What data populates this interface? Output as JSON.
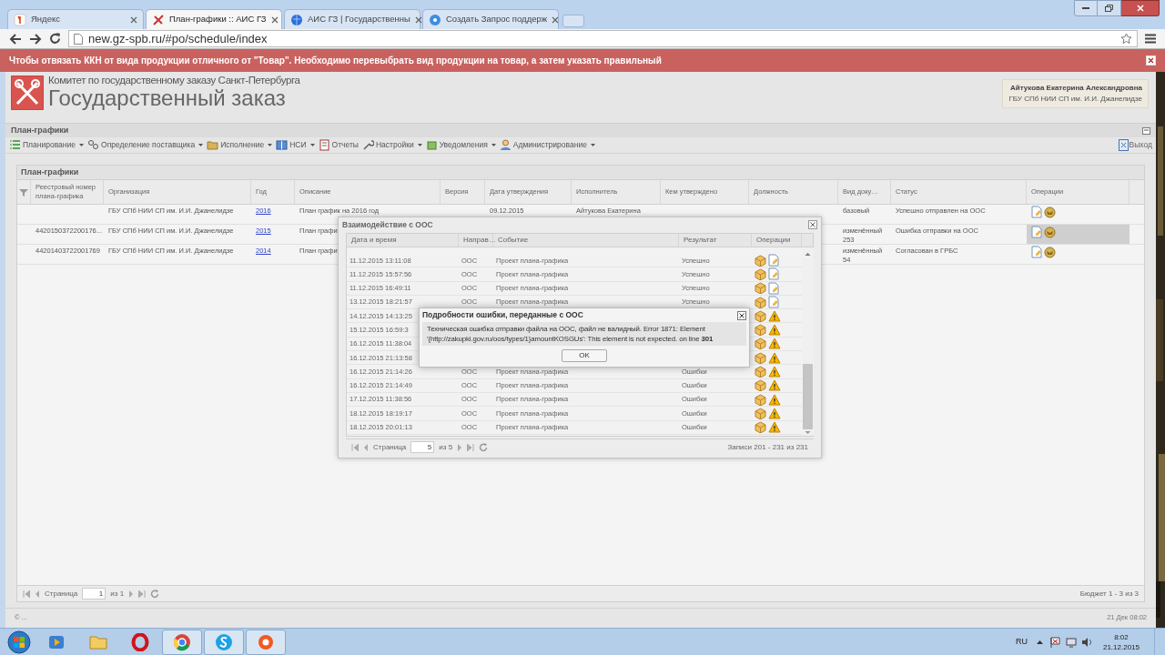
{
  "browser": {
    "tabs": [
      {
        "title": "Яндекс",
        "selected": false
      },
      {
        "title": "План-графики :: АИС ГЗ",
        "selected": true
      },
      {
        "title": "АИС ГЗ | Государственны",
        "selected": false
      },
      {
        "title": "Создать Запрос поддерж",
        "selected": false
      }
    ],
    "url": "new.gz-spb.ru/#po/schedule/index"
  },
  "banner": {
    "message": "Чтобы отвязать ККН от вида продукции отличного от \"Товар\". Необходимо перевыбрать вид продукции на товар, а затем указать правильный"
  },
  "header": {
    "subtitle": "Комитет по государственному заказу Санкт-Петербурга",
    "title": "Государственный заказ",
    "user_name": "Айтукова Екатерина Александровна",
    "user_org": "ГБУ СПб НИИ СП им. И.И. Джанелидзе"
  },
  "section_title": "План-графики",
  "toolbar": {
    "items": [
      {
        "label": "Планирование",
        "has_menu": true
      },
      {
        "label": "Определение поставщика",
        "has_menu": true
      },
      {
        "label": "Исполнение",
        "has_menu": true
      },
      {
        "label": "НСИ",
        "has_menu": true
      },
      {
        "label": "Отчеты",
        "has_menu": false
      },
      {
        "label": "Настройки",
        "has_menu": true
      },
      {
        "label": "Уведомления",
        "has_menu": true
      },
      {
        "label": "Администрирование",
        "has_menu": true
      }
    ],
    "logout": "Выход"
  },
  "table": {
    "title": "План-графики",
    "columns": [
      "Реестровый номер плана-графика",
      "Организация",
      "Год",
      "Описание",
      "Версия",
      "Дата утверждения",
      "Исполнитель",
      "Кем утверждено",
      "Должность",
      "Вид доку…",
      "Статус",
      "Операции"
    ],
    "rows": [
      {
        "cells": [
          null,
          "ГБУ СПб НИИ СП им. И.И. Джанелидзе",
          "2016",
          "План график на 2016 год",
          null,
          "09.12.2015",
          "Айтукова Екатерина",
          null,
          null,
          "базовый",
          "Успешно отправлен на ООС"
        ],
        "selected": false
      },
      {
        "cells": [
          "4420150372200176...",
          "ГБУ СПб НИИ СП им. И.И. Джанелидзе",
          "2015",
          "План графи",
          null,
          null,
          null,
          null,
          null,
          "изменённый 253",
          "Ошибка отправки на ООС"
        ],
        "selected": true
      },
      {
        "cells": [
          "44201403722001769",
          "ГБУ СПб НИИ СП им. И.И. Джанелидзе",
          "2014",
          "План графи",
          null,
          null,
          null,
          null,
          null,
          "изменённый 54",
          "Согласован в ГРБС"
        ],
        "selected": false
      }
    ],
    "pager": {
      "page_label": "Страница",
      "page": "1",
      "of": "из 1",
      "summary": "Бюджет 1 - 3 из 3"
    }
  },
  "footer": {
    "left": "© ...",
    "right": "21 Дек 08:02"
  },
  "dialog": {
    "title": "Взаимодействие с ООС",
    "columns": [
      "Дата и время",
      "Направ…",
      "Событие",
      "Результат",
      "Операции"
    ],
    "rows": [
      {
        "datetime": "11.12.2015 13:11:08",
        "direction": "ООС",
        "event": "Проект плана-графика",
        "result": "Успешно",
        "kind": "success"
      },
      {
        "datetime": "11.12.2015 15:57:56",
        "direction": "ООС",
        "event": "Проект плана-графика",
        "result": "Успешно",
        "kind": "success"
      },
      {
        "datetime": "11.12.2015 16:49:11",
        "direction": "ООС",
        "event": "Проект плана-графика",
        "result": "Успешно",
        "kind": "success"
      },
      {
        "datetime": "13.12.2015 18:21:57",
        "direction": "ООС",
        "event": "Проект плана-графика",
        "result": "Успешно",
        "kind": "success"
      },
      {
        "datetime": "14.12.2015 14:13:25",
        "kind": "error"
      },
      {
        "datetime": "15.12.2015 16:59:3",
        "kind": "error"
      },
      {
        "datetime": "16.12.2015 11:38:04",
        "kind": "error"
      },
      {
        "datetime": "16.12.2015 21:13:58",
        "kind": "error"
      },
      {
        "datetime": "16.12.2015 21:14:26",
        "direction": "ООС",
        "event": "Проект плана-графика",
        "result": "Ошибки",
        "kind": "error"
      },
      {
        "datetime": "16.12.2015 21:14:49",
        "direction": "ООС",
        "event": "Проект плана-графика",
        "result": "Ошибки",
        "kind": "error"
      },
      {
        "datetime": "17.12.2015 11:38:56",
        "direction": "ООС",
        "event": "Проект плана-графика",
        "result": "Ошибки",
        "kind": "error"
      },
      {
        "datetime": "18.12.2015 18:19:17",
        "direction": "ООС",
        "event": "Проект плана-графика",
        "result": "Ошибки",
        "kind": "error"
      },
      {
        "datetime": "18.12.2015 20:01:13",
        "direction": "ООС",
        "event": "Проект плана-графика",
        "result": "Ошибки",
        "kind": "error"
      }
    ],
    "pager": {
      "page_label": "Страница",
      "page": "5",
      "of": "из 5",
      "summary": "Записи 201 - 231 из 231"
    }
  },
  "error_dialog": {
    "title": "Подробности ошибки, переданные с ООС",
    "message": "Техническая ошибка отправки файла на ООС, файл не валидный. Error 1871: Element '{http://zakupki.gov.ru/oos/types/1}amountKOSGUs': This element is not expected. on line **301**",
    "button": "OK"
  },
  "taskbar": {
    "apps": [
      {
        "selected": false
      },
      {
        "selected": false
      },
      {
        "selected": false
      },
      {
        "selected": true
      },
      {
        "selected": true
      },
      {
        "selected": true
      }
    ],
    "language": "RU",
    "time": "8:02",
    "date": "21.12.2015"
  }
}
